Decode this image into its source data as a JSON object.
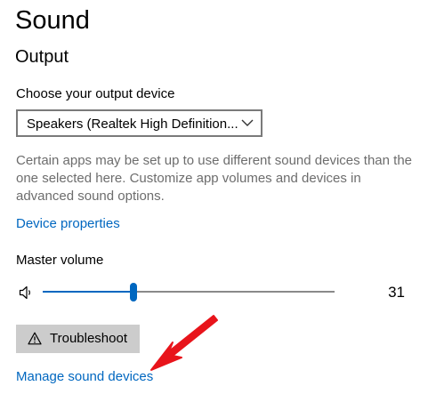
{
  "page": {
    "title": "Sound"
  },
  "output": {
    "section_title": "Output",
    "device_label": "Choose your output device",
    "device_selected": "Speakers (Realtek High Definition...",
    "description": "Certain apps may be set up to use different sound devices than the one selected here. Customize app volumes and devices in advanced sound options.",
    "device_properties_link": "Device properties",
    "master_volume_label": "Master volume",
    "volume": {
      "value": "31",
      "fraction": 0.31
    },
    "troubleshoot_label": "Troubleshoot",
    "manage_link": "Manage sound devices"
  },
  "colors": {
    "accent": "#0067c0",
    "link": "#0067c0",
    "secondary_text": "#6d6d6d",
    "button_bg": "#cccccc",
    "annotation_arrow": "#e8141b"
  },
  "icons": [
    "chevron-down-icon",
    "speaker-icon",
    "warning-icon",
    "annotation-arrow"
  ]
}
